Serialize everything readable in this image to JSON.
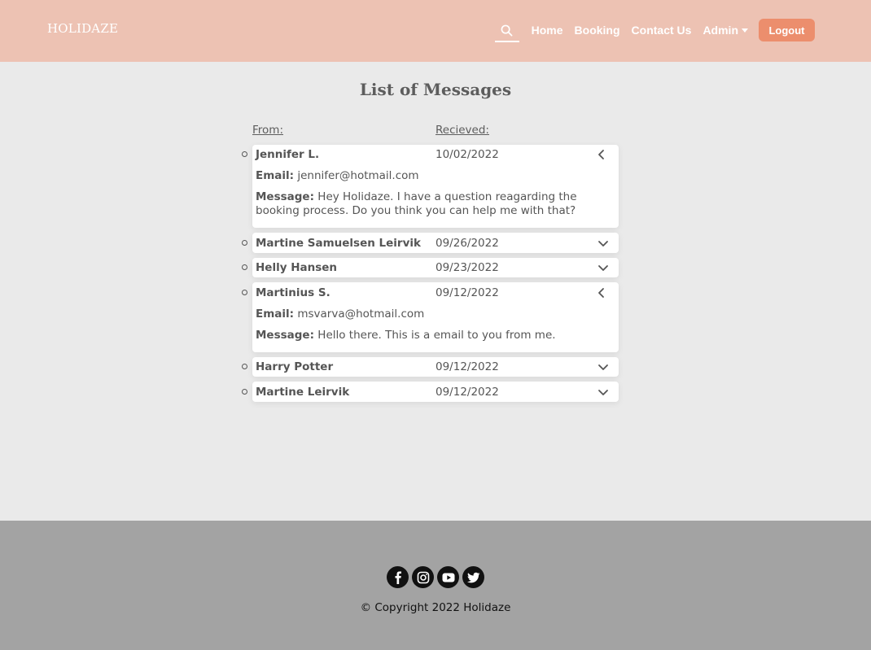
{
  "header": {
    "logo": "HOLIDAZE",
    "nav": {
      "search_icon": "search-icon",
      "home": "Home",
      "booking": "Booking",
      "contact": "Contact Us",
      "admin": "Admin",
      "logout": "Logout"
    }
  },
  "main": {
    "title": "List of Messages",
    "columns": {
      "from": "From:",
      "received": "Recieved:"
    },
    "email_label": "Email:",
    "message_label": "Message:",
    "messages": [
      {
        "name": "Jennifer L.",
        "date": "10/02/2022",
        "expanded": true,
        "email": "jennifer@hotmail.com",
        "message": "Hey Holidaze. I have a question reagarding the booking process. Do you think you can help me with that?"
      },
      {
        "name": "Martine Samuelsen Leirvik",
        "date": "09/26/2022",
        "expanded": false
      },
      {
        "name": "Helly Hansen",
        "date": "09/23/2022",
        "expanded": false
      },
      {
        "name": "Martinius S.",
        "date": "09/12/2022",
        "expanded": true,
        "email": "msvarva@hotmail.com",
        "message": "Hello there. This is a email to you from me."
      },
      {
        "name": "Harry Potter",
        "date": "09/12/2022",
        "expanded": false
      },
      {
        "name": "Martine Leirvik",
        "date": "09/12/2022",
        "expanded": false
      }
    ]
  },
  "footer": {
    "socials": [
      "facebook-icon",
      "instagram-icon",
      "youtube-icon",
      "twitter-icon"
    ],
    "copyright": "© Copyright 2022 Holidaze"
  },
  "colors": {
    "header_bg": "#edc2b3",
    "logout_bg": "#ec8e6d",
    "page_bg": "#eaeaea",
    "footer_bg": "#a3a3a3"
  }
}
